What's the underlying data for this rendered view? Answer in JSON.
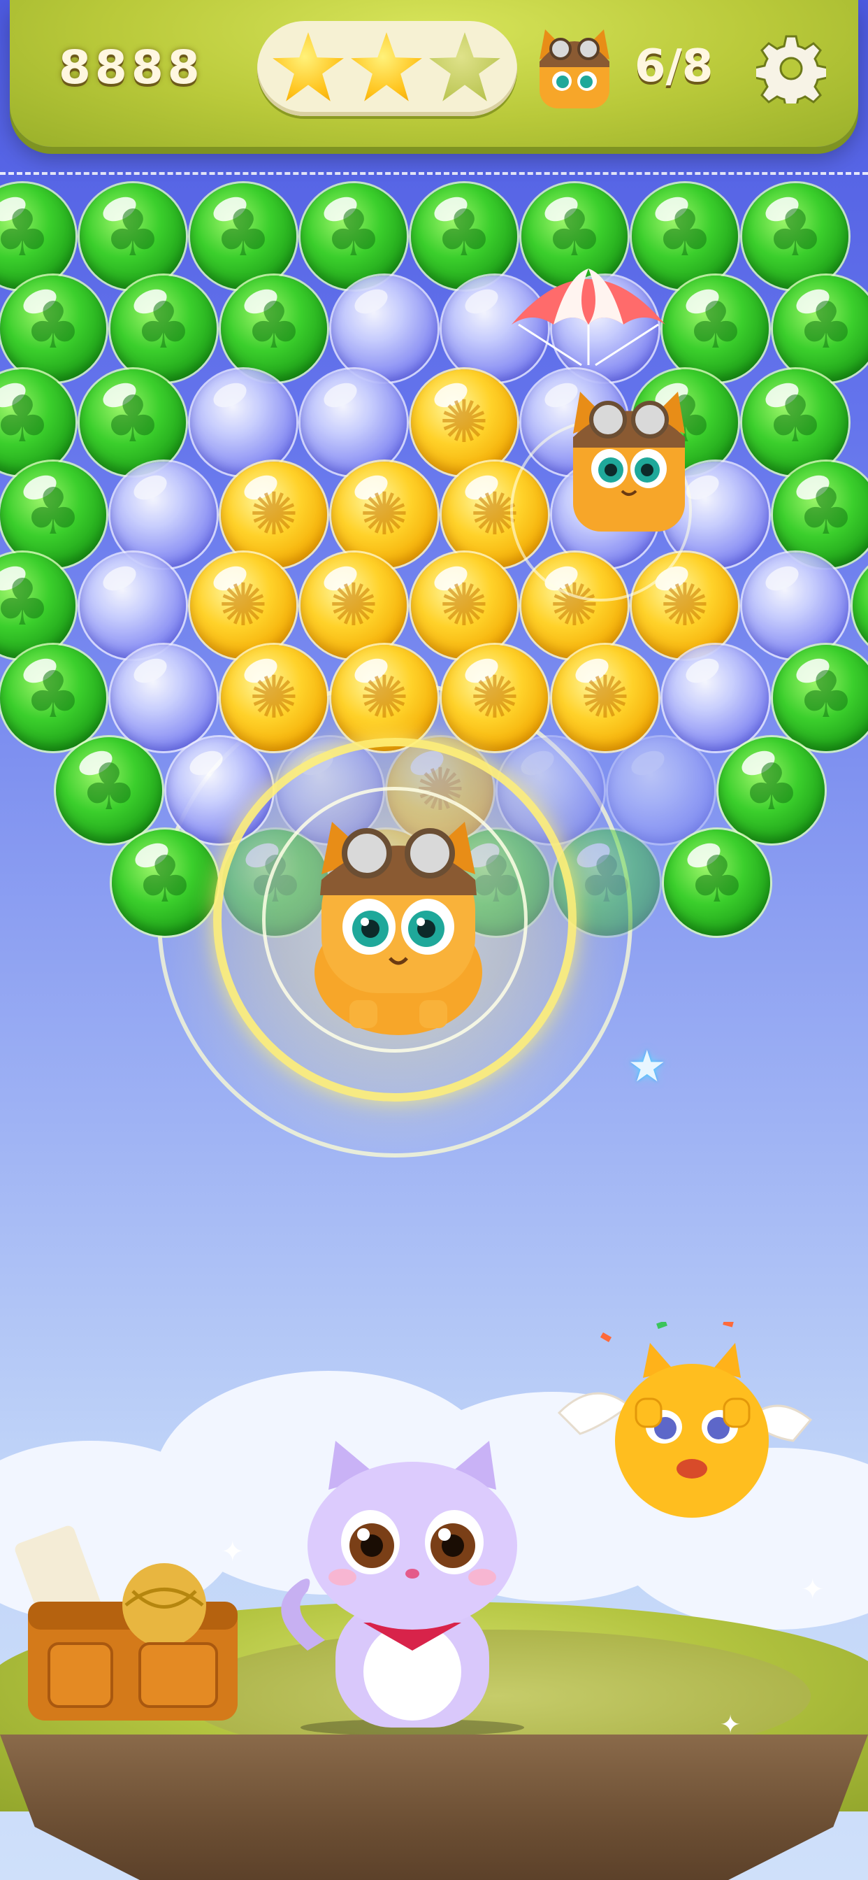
{
  "hud": {
    "score": "8888",
    "stars_earned": 2,
    "stars_total": 3,
    "rescue_progress": "6/8",
    "rescue_icon": "pilot-cat-icon",
    "settings_icon": "gear-icon"
  },
  "board": {
    "bubble_colors": {
      "green": "#2fbf22",
      "blue": "#7e82f2",
      "yellow": "#ffc21a"
    },
    "rows": [
      "GGGGGGGG",
      "GGGBBBGG",
      "GGBBYBGG",
      "GBYYYBBG",
      "GBYYYYYBG",
      "GBYYYYBG",
      "GBBYBBG",
      "GGYGGG"
    ]
  },
  "characters": {
    "falling_cat": "pilot-cat-parachute",
    "freed_cat": "pilot-cat-freed",
    "shooter": "purple-cat-shooter",
    "helper": "winged-yellow-cat",
    "booster_bag": "satchel-booster"
  },
  "colors": {
    "sky_top": "#4d5ae0",
    "sky_bottom": "#cfe0fa",
    "hud_green": "#b9c93a",
    "text_cream": "#fff7e0"
  }
}
